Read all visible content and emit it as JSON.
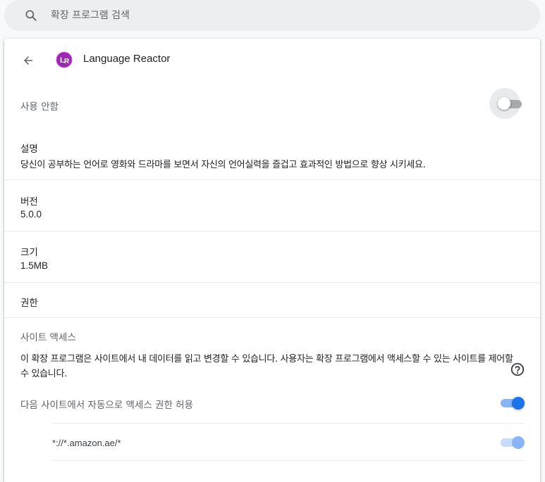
{
  "search": {
    "placeholder": "확장 프로그램 검색"
  },
  "header": {
    "extension_name": "Language Reactor"
  },
  "enable": {
    "label": "사용 안함",
    "enabled": false
  },
  "description": {
    "title": "설명",
    "text": "당신이 공부하는 언어로 영화와 드라마를 보면서 자신의 언어실력을 즐겁고 효과적인 방법으로 향상 시키세요."
  },
  "version": {
    "title": "버전",
    "value": "5.0.0"
  },
  "size": {
    "title": "크기",
    "value": "1.5MB"
  },
  "permissions": {
    "title": "권한"
  },
  "site_access": {
    "title": "사이트 액세스",
    "text": "이 확장 프로그램은 사이트에서 내 데이터를 읽고 변경할 수 있습니다. 사용자는 확장 프로그램에서 액세스할 수 있는 사이트를 제어할 수 있습니다.",
    "auto_label": "다음 사이트에서 자동으로 액세스 권한 허용",
    "auto_enabled": true,
    "sites": [
      {
        "pattern": "*://*.amazon.ae/*",
        "enabled": true
      }
    ]
  },
  "colors": {
    "accent": "#1a73e8",
    "accent_light": "#8ab4f8",
    "logo": "#9c27b0"
  },
  "icons": {
    "search": "search-icon",
    "back": "arrow-back-icon",
    "help": "help-circle-icon"
  }
}
